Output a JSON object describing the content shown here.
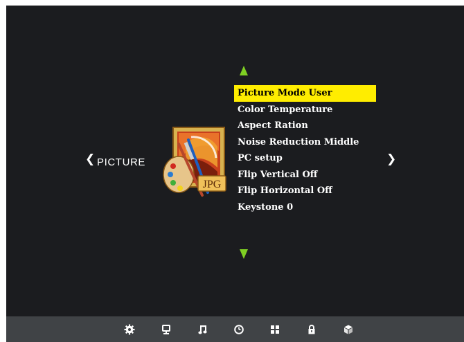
{
  "section": {
    "label": "PICTURE",
    "prev_icon": "chevron-left-icon",
    "next_icon": "chevron-right-icon",
    "category_icon": "jpg-picture-icon",
    "category_icon_text": "JPG"
  },
  "menu": {
    "items": [
      {
        "label": "Picture Mode User",
        "selected": true
      },
      {
        "label": "Color Temperature",
        "selected": false
      },
      {
        "label": "Aspect Ration",
        "selected": false
      },
      {
        "label": "Noise Reduction Middle",
        "selected": false
      },
      {
        "label": "PC setup",
        "selected": false
      },
      {
        "label": "Flip Vertical Off",
        "selected": false
      },
      {
        "label": "Flip Horizontal Off",
        "selected": false
      },
      {
        "label": "Keystone 0",
        "selected": false
      }
    ],
    "scroll_up_icon": "triangle-up-icon",
    "scroll_down_icon": "triangle-down-icon"
  },
  "bottom_tabs": [
    {
      "icon": "gear-icon",
      "active": true
    },
    {
      "icon": "monitor-icon",
      "active": false
    },
    {
      "icon": "music-note-icon",
      "active": false
    },
    {
      "icon": "clock-icon",
      "active": false
    },
    {
      "icon": "grid-icon",
      "active": false
    },
    {
      "icon": "lock-icon",
      "active": false
    },
    {
      "icon": "cube-icon",
      "active": false
    }
  ],
  "colors": {
    "background": "#1b1c1f",
    "highlight": "#ffed00",
    "arrow": "#7fcf23",
    "bottom_bar": "#404346",
    "text": "#ffffff"
  }
}
